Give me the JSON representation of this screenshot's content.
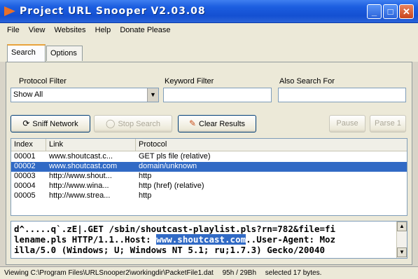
{
  "window": {
    "title": "Project URL Snooper   V2.03.08"
  },
  "menu": {
    "items": [
      "File",
      "View",
      "Websites",
      "Help",
      "Donate Please"
    ]
  },
  "tabs": [
    {
      "label": "Search",
      "active": true
    },
    {
      "label": "Options",
      "active": false
    }
  ],
  "filters": {
    "protocol_label": "Protocol Filter",
    "protocol_value": "Show All",
    "keyword_label": "Keyword Filter",
    "keyword_value": "",
    "also_label": "Also Search For",
    "also_value": ""
  },
  "buttons": {
    "sniff": "Sniff Network",
    "stop": "Stop Search",
    "clear": "Clear Results",
    "pause": "Pause",
    "parse": "Parse 1"
  },
  "list": {
    "headers": [
      "Index",
      "Link",
      "Protocol"
    ],
    "rows": [
      {
        "index": "00001",
        "link": "www.shoutcast.c...",
        "protocol": "GET pls file (relative)",
        "selected": false
      },
      {
        "index": "00002",
        "link": "www.shoutcast.com",
        "protocol": "domain/unknown",
        "selected": true
      },
      {
        "index": "00003",
        "link": "http://www.shout...",
        "protocol": "http",
        "selected": false
      },
      {
        "index": "00004",
        "link": "http://www.wina...",
        "protocol": "http (href) (relative)",
        "selected": false
      },
      {
        "index": "00005",
        "link": "http://www.strea...",
        "protocol": "http",
        "selected": false
      }
    ]
  },
  "packet": {
    "line1": "d^.....q`.zE|.GET /sbin/shoutcast-playlist.pls?rn=782&file=fi",
    "line2_pre": "lename.pls HTTP/1.1..Host: ",
    "line2_highlight": "www.shoutcast.com",
    "line2_post": "..User-Agent: Moz",
    "line3": "illa/5.0 (Windows; U; Windows NT 5.1; ru;1.7.3) Gecko/20040"
  },
  "status": {
    "file": "Viewing C:\\Program Files\\URLSnooper2\\workingdir\\PacketFile1.dat",
    "position": "95h / 29Bh",
    "selection": "selected 17 bytes."
  },
  "colors": {
    "titlebar": "#1c5ee0",
    "selection": "#316ac5",
    "tab_accent": "#e8a33c"
  }
}
